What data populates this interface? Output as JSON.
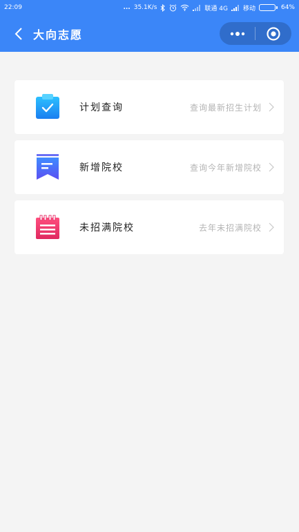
{
  "status_bar": {
    "time": "22:09",
    "dots": "...",
    "net_speed": "35.1K/s",
    "carrier1": "联通 4G",
    "carrier2": "移动",
    "battery": "64%",
    "battery_level": 0.64
  },
  "nav": {
    "title": "大向志愿",
    "back_icon": "chevron-left-icon",
    "more_icon": "more-dots-icon",
    "close_icon": "target-close-icon",
    "color": "#3b86f8"
  },
  "items": [
    {
      "title": "计划查询",
      "desc": "查询最新招生计划",
      "icon": "clipboard-check-icon",
      "color": "#1e8ef4"
    },
    {
      "title": "新增院校",
      "desc": "查询今年新增院校",
      "icon": "bookmark-icon",
      "color": "#4a6cf7"
    },
    {
      "title": "未招满院校",
      "desc": "去年未招满院校",
      "icon": "notepad-icon",
      "color": "#e8316b"
    }
  ]
}
